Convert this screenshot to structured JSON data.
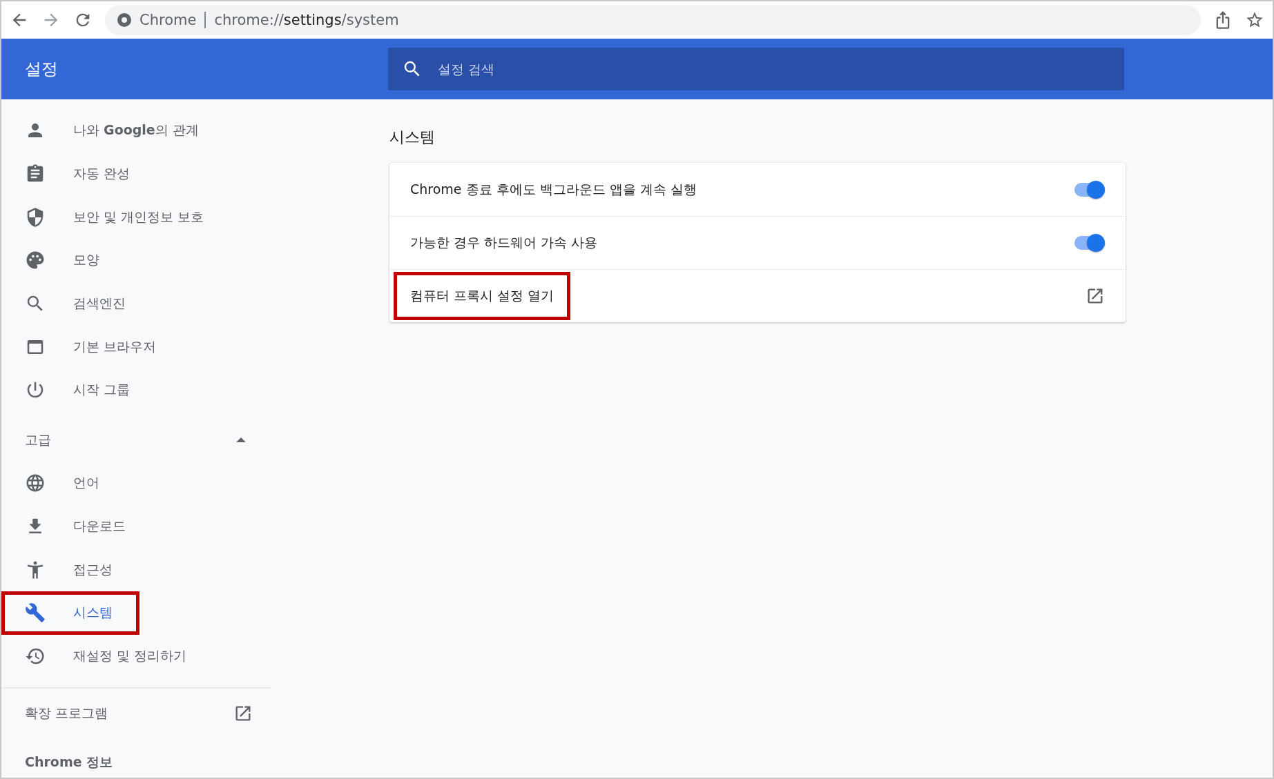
{
  "browser": {
    "site_label": "Chrome",
    "url_host": "chrome://",
    "url_path": "settings",
    "url_rest": "/system"
  },
  "header": {
    "title": "설정",
    "search": {
      "placeholder": "설정 검색"
    }
  },
  "sidebar": {
    "items": [
      {
        "label": "나와 **Google**의 관계",
        "selected": false,
        "highlighted": false
      },
      {
        "label": "자동 완성",
        "selected": false,
        "highlighted": false
      },
      {
        "label": "보안 및 개인정보 보호",
        "selected": false,
        "highlighted": false
      },
      {
        "label": "모양",
        "selected": false,
        "highlighted": false
      },
      {
        "label": "검색엔진",
        "selected": false,
        "highlighted": false
      },
      {
        "label": "기본 브라우저",
        "selected": false,
        "highlighted": false
      },
      {
        "label": "시작 그룹",
        "selected": false,
        "highlighted": false
      }
    ],
    "advanced": {
      "label": "고급",
      "expanded": true,
      "items": [
        {
          "label": "언어",
          "selected": false,
          "highlighted": false
        },
        {
          "label": "다운로드",
          "selected": false,
          "highlighted": false
        },
        {
          "label": "접근성",
          "selected": false,
          "highlighted": false
        },
        {
          "label": "시스템",
          "selected": true,
          "highlighted": true
        },
        {
          "label": "재설정 및 정리하기",
          "selected": false,
          "highlighted": false
        }
      ]
    },
    "extensions": "확장 프로그램",
    "about": "Chrome 정보"
  },
  "section": {
    "title": "시스템",
    "rows": [
      {
        "kind": "toggle",
        "label": "Chrome 종료 후에도 백그라운드 앱을 계속 실행",
        "on": true,
        "highlighted": false
      },
      {
        "kind": "toggle",
        "label": "가능한 경우 하드웨어 가속 사용",
        "on": true,
        "highlighted": false
      },
      {
        "kind": "link",
        "label": "컴퓨터 프록시 설정 열기",
        "highlighted": true
      }
    ]
  }
}
